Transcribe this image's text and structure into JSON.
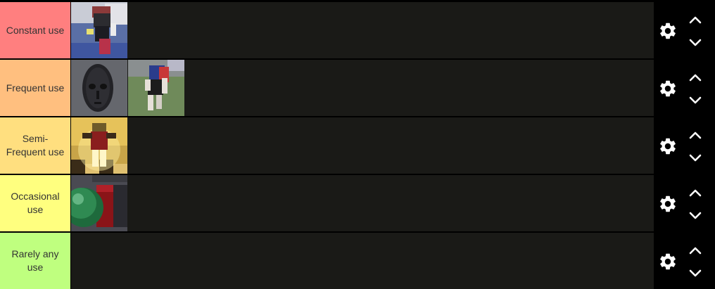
{
  "tiers": [
    {
      "label": "Constant use",
      "color": "#ff7f7f",
      "items": [
        {
          "icon": "roblox-character-cape-image"
        }
      ]
    },
    {
      "label": "Frequent use",
      "color": "#ffbf7f",
      "items": [
        {
          "icon": "stone-mask-image"
        },
        {
          "icon": "roblox-character-grass-image"
        }
      ]
    },
    {
      "label": "Semi-Frequent use",
      "color": "#ffdf7f",
      "items": [
        {
          "icon": "glowing-character-image"
        }
      ]
    },
    {
      "label": "Occasional use",
      "color": "#ffff7f",
      "items": [
        {
          "icon": "green-orb-image"
        }
      ]
    },
    {
      "label": "Rarely any use",
      "color": "#bfff7f",
      "items": []
    }
  ],
  "controls": {
    "settings_icon": "gear-icon",
    "move_up_icon": "chevron-up-icon",
    "move_down_icon": "chevron-down-icon"
  }
}
